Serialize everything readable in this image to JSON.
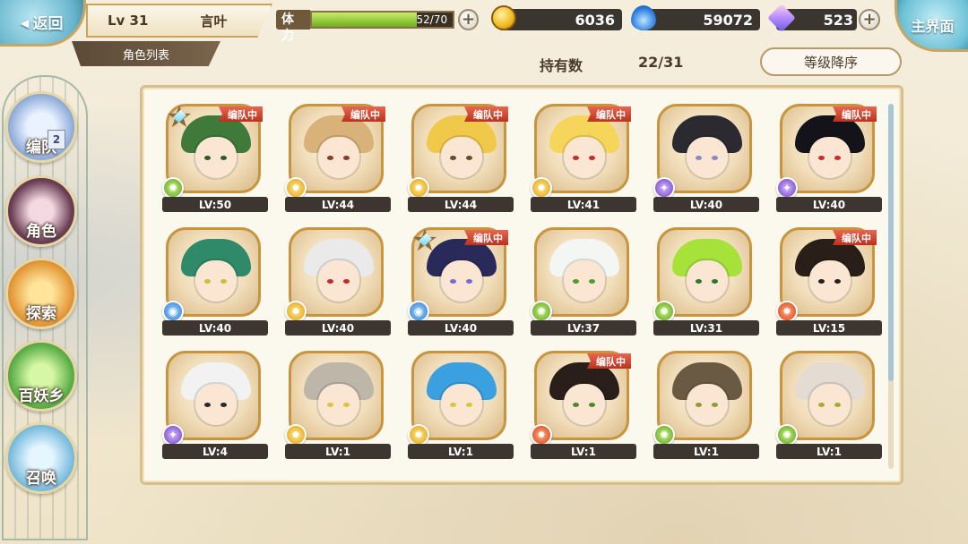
{
  "header": {
    "back_label": "返回",
    "player_level": "Lv 31",
    "player_name": "言叶",
    "tab_label": "角色列表",
    "main_label": "主界面"
  },
  "stamina": {
    "label": "体力",
    "text": "52/70",
    "fill_fraction": 0.743
  },
  "currencies": {
    "gold": "6036",
    "spirit": "59072",
    "crystal": "523"
  },
  "roster": {
    "count_label": "持有数",
    "count_value": "22/31",
    "sort_label": "等级降序"
  },
  "nav": [
    {
      "label": "编队",
      "badge": "2"
    },
    {
      "label": "角色"
    },
    {
      "label": "探索"
    },
    {
      "label": "百妖乡"
    },
    {
      "label": "召唤"
    }
  ],
  "team_tag_text": "编队中",
  "characters": [
    {
      "level": "LV:50",
      "element": "wind",
      "in_team": true,
      "starred": true,
      "hair": "#3f7a3a",
      "eyes": "#2f5a2a"
    },
    {
      "level": "LV:44",
      "element": "light",
      "in_team": true,
      "starred": false,
      "hair": "#d9b27a",
      "eyes": "#8a3a2a"
    },
    {
      "level": "LV:44",
      "element": "light",
      "in_team": true,
      "starred": false,
      "hair": "#f0c84a",
      "eyes": "#6a4a2a"
    },
    {
      "level": "LV:41",
      "element": "light",
      "in_team": true,
      "starred": false,
      "hair": "#f6d65a",
      "eyes": "#c0302a"
    },
    {
      "level": "LV:40",
      "element": "dark",
      "in_team": false,
      "starred": false,
      "hair": "#2a2a30",
      "eyes": "#8a8ac0"
    },
    {
      "level": "LV:40",
      "element": "dark",
      "in_team": true,
      "starred": false,
      "hair": "#15131a",
      "eyes": "#d02a2a"
    },
    {
      "level": "LV:40",
      "element": "water",
      "in_team": false,
      "starred": false,
      "hair": "#2f8a6a",
      "eyes": "#c8c03a"
    },
    {
      "level": "LV:40",
      "element": "light",
      "in_team": false,
      "starred": false,
      "hair": "#eaeaea",
      "eyes": "#c02a2a"
    },
    {
      "level": "LV:40",
      "element": "water",
      "in_team": true,
      "starred": true,
      "hair": "#2a2a5a",
      "eyes": "#7a6ad0"
    },
    {
      "level": "LV:37",
      "element": "wind",
      "in_team": false,
      "starred": false,
      "hair": "#f4f6f4",
      "eyes": "#4aa02a"
    },
    {
      "level": "LV:31",
      "element": "wind",
      "in_team": false,
      "starred": false,
      "hair": "#a6e23a",
      "eyes": "#2a7a2a"
    },
    {
      "level": "LV:15",
      "element": "fire",
      "in_team": true,
      "starred": false,
      "hair": "#2a1e18",
      "eyes": "#2a1e18"
    },
    {
      "level": "LV:4",
      "element": "dark",
      "in_team": false,
      "starred": false,
      "hair": "#f2f2f2",
      "eyes": "#2a2a2a"
    },
    {
      "level": "LV:1",
      "element": "light",
      "in_team": false,
      "starred": false,
      "hair": "#bfb6aa",
      "eyes": "#d6c83a"
    },
    {
      "level": "LV:1",
      "element": "light",
      "in_team": false,
      "starred": false,
      "hair": "#3aa0e0",
      "eyes": "#d6c83a"
    },
    {
      "level": "LV:1",
      "element": "fire",
      "in_team": true,
      "starred": false,
      "hair": "#2a1e1a",
      "eyes": "#4a8a2a"
    },
    {
      "level": "LV:1",
      "element": "wind",
      "in_team": false,
      "starred": false,
      "hair": "#6a5a44",
      "eyes": "#8aa02a"
    },
    {
      "level": "LV:1",
      "element": "wind",
      "in_team": false,
      "starred": false,
      "hair": "#e4dcd2",
      "eyes": "#a0b02a"
    }
  ],
  "colors": {
    "frame_gold": "#c8953e",
    "team_tag": "#c9432e",
    "level_bar": "#3d3630",
    "panel_bg": "#fbf8ee"
  }
}
